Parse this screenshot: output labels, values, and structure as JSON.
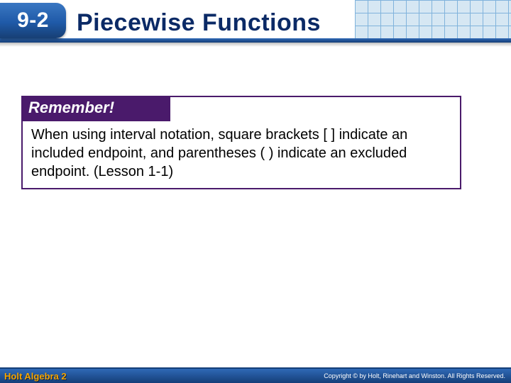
{
  "header": {
    "section_number": "9-2",
    "title": "Piecewise Functions"
  },
  "callout": {
    "label": "Remember!",
    "body": "When using interval notation, square brackets [ ] indicate an included endpoint, and parentheses ( ) indicate an excluded endpoint. (Lesson 1-1)"
  },
  "footer": {
    "book": "Holt Algebra 2",
    "copyright": "Copyright © by Holt, Rinehart and Winston. All Rights Reserved."
  }
}
